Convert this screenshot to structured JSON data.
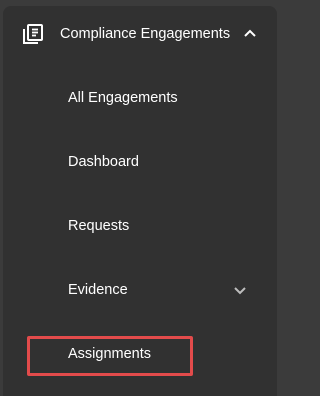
{
  "nav": {
    "section": {
      "label": "Compliance Engagements",
      "icon": "engagements-icon",
      "expanded_icon": "chevron-up-icon"
    },
    "items": [
      {
        "label": "All Engagements"
      },
      {
        "label": "Dashboard"
      },
      {
        "label": "Requests"
      },
      {
        "label": "Evidence",
        "icon": "chevron-down-icon"
      },
      {
        "label": "Assignments"
      }
    ]
  },
  "colors": {
    "background": "#3b3b3b",
    "panel": "#313131",
    "text": "#ffffff",
    "highlight": "#e24b4b"
  }
}
